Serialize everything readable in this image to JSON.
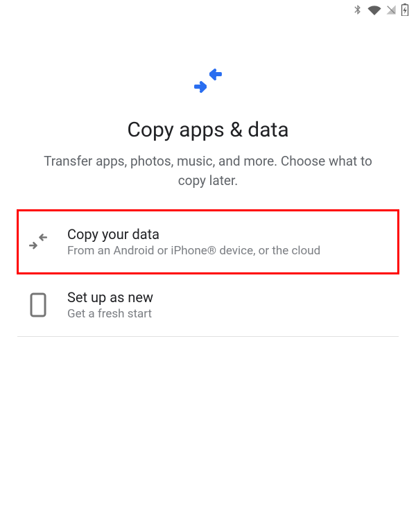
{
  "header": {
    "title": "Copy apps & data",
    "subtitle": "Transfer apps, photos, music, and more. Choose what to copy later."
  },
  "options": {
    "copy": {
      "title": "Copy your data",
      "subtitle": "From an Android or iPhone® device, or the cloud"
    },
    "new": {
      "title": "Set up as new",
      "subtitle": "Get a fresh start"
    }
  }
}
